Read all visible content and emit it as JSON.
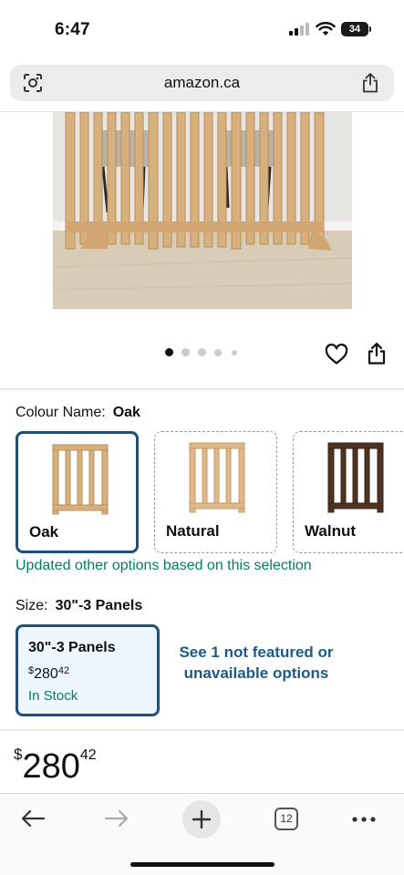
{
  "status_bar": {
    "time": "6:47",
    "battery": "34"
  },
  "browser": {
    "url": "amazon.ca"
  },
  "gallery": {
    "image_count": 5,
    "active_index": 0
  },
  "colour": {
    "label": "Colour Name:",
    "selected": "Oak",
    "options": [
      {
        "name": "Oak",
        "color": "#d8b07e",
        "selected": true
      },
      {
        "name": "Natural",
        "color": "#e0b88a",
        "selected": false
      },
      {
        "name": "Walnut",
        "color": "#4e3222",
        "selected": false
      }
    ],
    "update_note": "Updated other options based on this selection"
  },
  "size": {
    "label": "Size:",
    "selected": "30\"-3 Panels",
    "option": {
      "title": "30\"-3 Panels",
      "price_symbol": "$",
      "price_whole": "280",
      "price_cents": "42",
      "stock": "In Stock"
    },
    "see_more": "See 1 not featured or unavailable options"
  },
  "price": {
    "symbol": "$",
    "whole": "280",
    "cents": "42"
  },
  "toolbar": {
    "tab_count": "12"
  },
  "colors": {
    "accent": "#1f4f7a",
    "green": "#067d62",
    "link": "#1d5a86"
  }
}
